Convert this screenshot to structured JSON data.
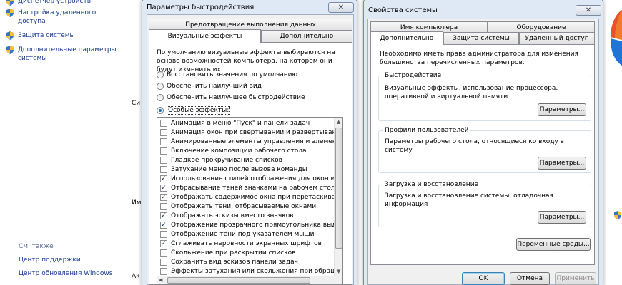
{
  "control_panel": {
    "items": [
      {
        "label": "Диспетчер устройств"
      },
      {
        "label": "Настройка удаленного доступа"
      },
      {
        "label": "Защита системы"
      },
      {
        "label": "Дополнительные параметры системы"
      }
    ],
    "see_also_title": "См. также",
    "links": [
      "Центр поддержки",
      "Центр обновления Windows"
    ],
    "partial_letters": [
      "Си",
      "Им",
      "Ак"
    ]
  },
  "perf_dialog": {
    "title": "Параметры быстродействия",
    "close_label": "✕",
    "tabs_back": "Предотвращение выполнения данных",
    "tabs_front": [
      "Визуальные эффекты",
      "Дополнительно"
    ],
    "intro": "По умолчанию визуальные эффекты выбираются на основе возможностей компьютера, на котором они будут изменить их.",
    "radios": [
      {
        "label": "Восстановить значения по умолчанию",
        "selected": false
      },
      {
        "label": "Обеспечить наилучший вид",
        "selected": false
      },
      {
        "label": "Обеспечить наилучшее быстродействие",
        "selected": false
      },
      {
        "label": "Особые эффекты:",
        "selected": true
      }
    ],
    "effects": [
      {
        "label": "Анимация в меню \"Пуск\" и панели задач",
        "checked": false
      },
      {
        "label": "Анимация окон при свертывании и развертывании",
        "checked": false
      },
      {
        "label": "Анимированные элементы управления и элементы вну",
        "checked": false
      },
      {
        "label": "Включение композиции рабочего стола",
        "checked": false
      },
      {
        "label": "Гладкое прокручивание списков",
        "checked": false
      },
      {
        "label": "Затухание меню после вызова команды",
        "checked": false
      },
      {
        "label": "Использование стилей отображения для окон и кнопо",
        "checked": true
      },
      {
        "label": "Отбрасывание теней значками на рабочем столе",
        "checked": true
      },
      {
        "label": "Отображать содержимое окна при перетаскивании",
        "checked": true
      },
      {
        "label": "Отображать тени, отбрасываемые окнами",
        "checked": false
      },
      {
        "label": "Отображать эскизы вместо значков",
        "checked": true
      },
      {
        "label": "Отображение прозрачного прямоугольника выделени",
        "checked": true
      },
      {
        "label": "Отображение тени под указателем мыши",
        "checked": false
      },
      {
        "label": "Сглаживать неровности экранных шрифтов",
        "checked": true
      },
      {
        "label": "Скольжение при раскрытии списков",
        "checked": false
      },
      {
        "label": "Сохранить вид эскизов панели задач",
        "checked": false
      },
      {
        "label": "Эффекты затухания или скольжения при обращении к",
        "checked": false
      }
    ]
  },
  "sys_dialog": {
    "title": "Свойства системы",
    "close_label": "✕",
    "tabs_back": [
      "Имя компьютера",
      "Оборудование"
    ],
    "tabs_front": [
      "Дополнительно",
      "Защита системы",
      "Удаленный доступ"
    ],
    "admin_note": "Необходимо иметь права администратора для изменения большинства перечисленных параметров.",
    "groups": [
      {
        "title": "Быстродействие",
        "text": "Визуальные эффекты, использование процессора, оперативной и виртуальной памяти",
        "button": "Параметры..."
      },
      {
        "title": "Профили пользователей",
        "text": "Параметры рабочего стола, относящиеся ко входу в систему",
        "button": "Параметры..."
      },
      {
        "title": "Загрузка и восстановление",
        "text": "Загрузка и восстановление системы, отладочная информация",
        "button": "Параметры..."
      }
    ],
    "env_button": "Переменные среды...",
    "ok": "OK",
    "cancel": "Отмена",
    "apply": "Применить"
  }
}
